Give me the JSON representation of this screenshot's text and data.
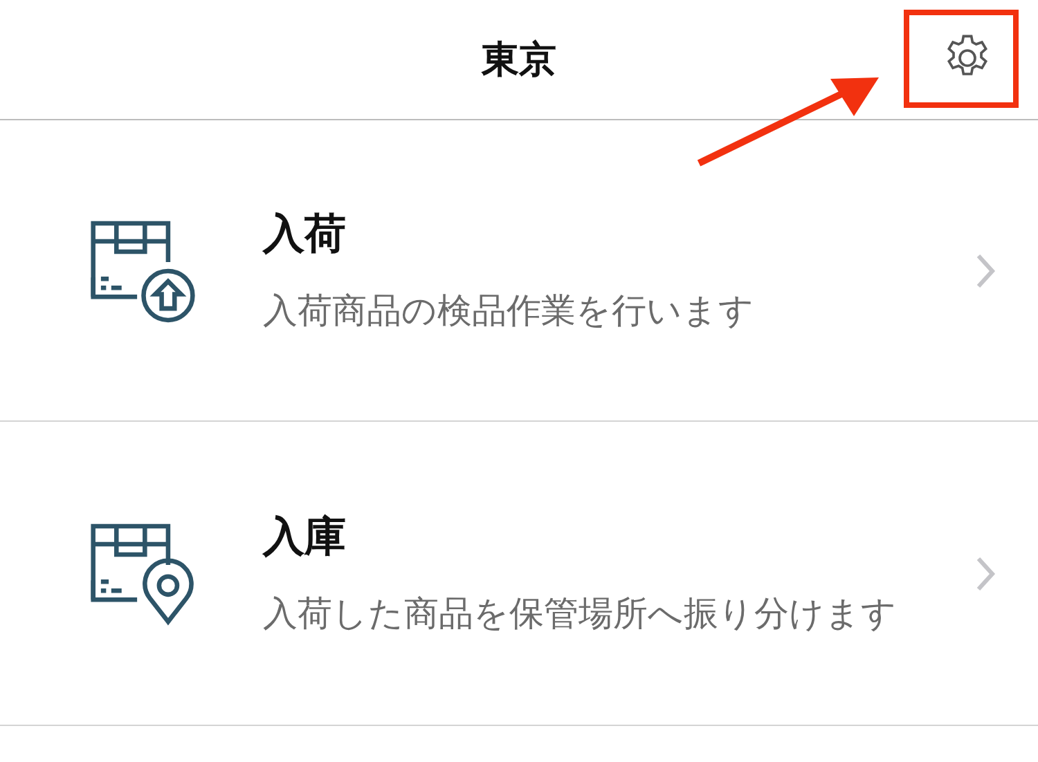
{
  "header": {
    "title": "東京"
  },
  "menu_items": [
    {
      "kind": "upload",
      "title": "入荷",
      "description": "入荷商品の検品作業を行います"
    },
    {
      "kind": "location",
      "title": "入庫",
      "description": "入荷した商品を保管場所へ振り分けます"
    }
  ]
}
